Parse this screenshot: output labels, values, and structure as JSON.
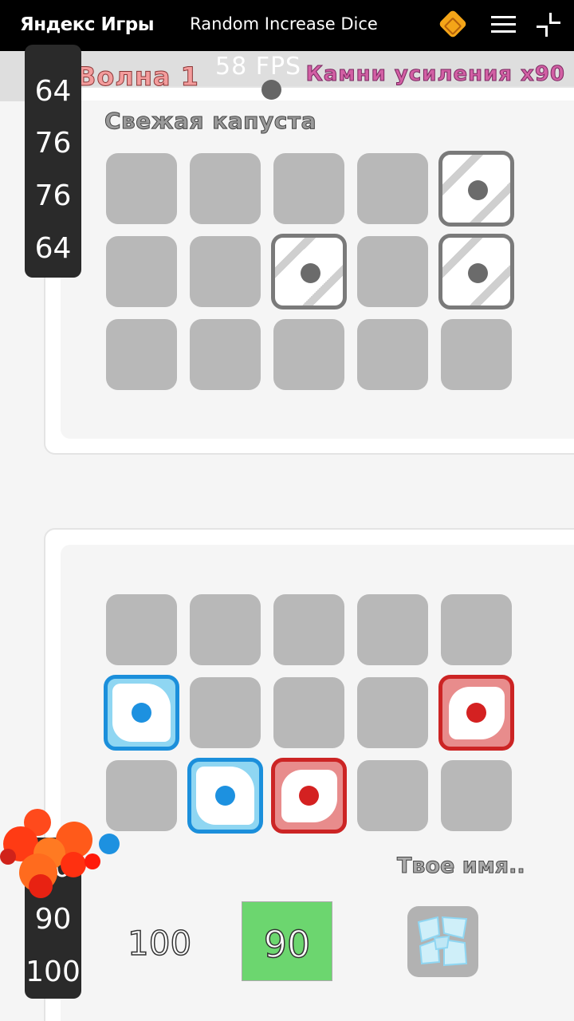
{
  "topbar": {
    "brand": "Яндекс Игры",
    "title": "Random Increase Dice",
    "icons": [
      "yandex-coin-icon",
      "hamburger-menu-icon",
      "collapse-icon"
    ]
  },
  "status": {
    "wave": "Волна 1",
    "fps": "58 FPS",
    "stones": "Камни усиления x90"
  },
  "enemy_board": {
    "name": "Свежая капуста",
    "rows": [
      [
        "empty",
        "empty",
        "empty",
        "empty",
        "gray"
      ],
      [
        "empty",
        "empty",
        "gray",
        "empty",
        "gray"
      ],
      [
        "empty",
        "empty",
        "empty",
        "empty",
        "empty"
      ]
    ]
  },
  "player_board": {
    "name": "Твое имя..",
    "rows": [
      [
        "empty",
        "empty",
        "empty",
        "empty",
        "empty"
      ],
      [
        "blue",
        "empty",
        "empty",
        "empty",
        "red"
      ],
      [
        "empty",
        "blue",
        "red",
        "empty",
        "empty"
      ]
    ]
  },
  "enemy_counters": [
    "64",
    "76",
    "76",
    "64"
  ],
  "player_counters": [
    "70",
    "90",
    "100"
  ],
  "controls": {
    "score": "100",
    "spawn_cost": "90",
    "upgrade_icon": "shattered-die-icon"
  },
  "colors": {
    "topbar": "#000000",
    "wave_text": "#f39c9c",
    "stones_text": "#d25fa4",
    "blue_die": "#1b8fdb",
    "red_die": "#cc2424",
    "spawn_button": "#6cd66f"
  }
}
